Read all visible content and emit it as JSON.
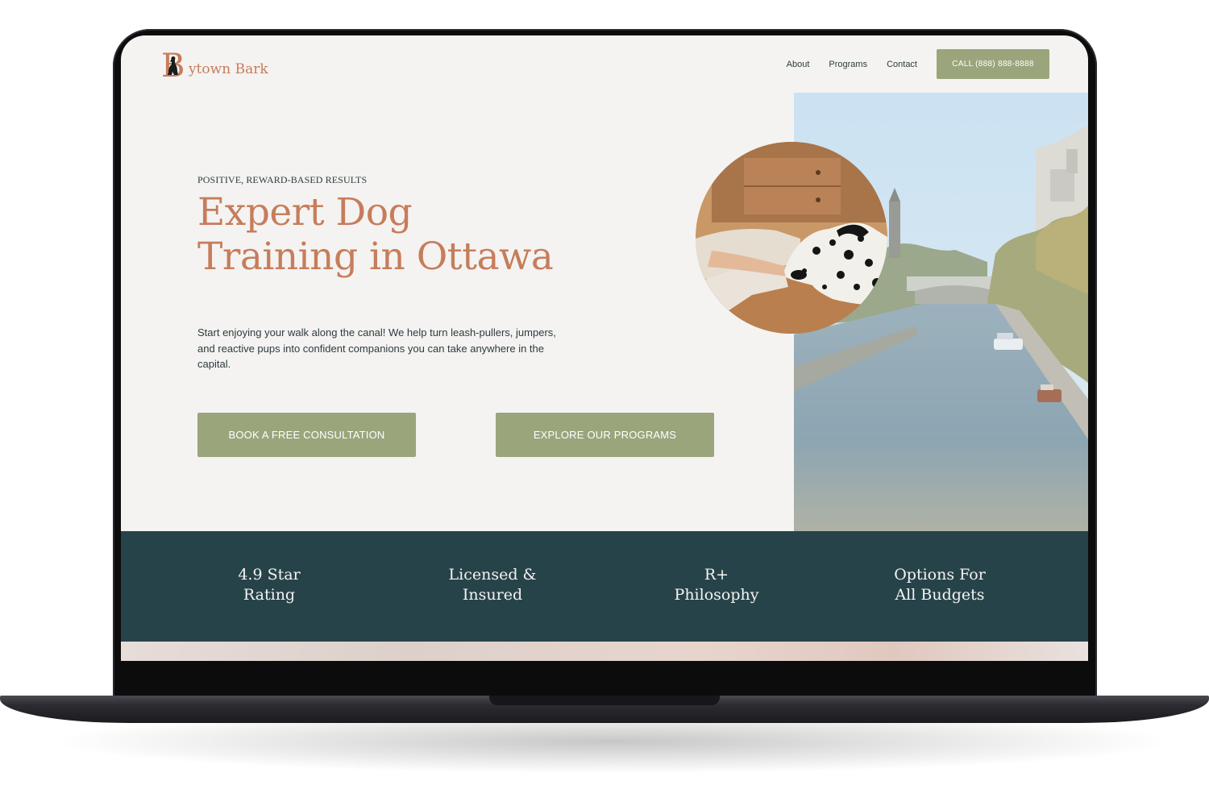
{
  "header": {
    "logo_letter": "B",
    "logo_text": "ytown Bark",
    "nav": [
      {
        "label": "About"
      },
      {
        "label": "Programs"
      },
      {
        "label": "Contact"
      }
    ],
    "call_button": "CALL (888) 888-8888"
  },
  "hero": {
    "eyebrow": "POSITIVE, REWARD-BASED RESULTS",
    "headline_line1": "Expert Dog",
    "headline_line2": "Training in Ottawa",
    "intro": "Start enjoying your walk along the canal! We help turn leash-pullers, jumpers, and reactive pups into confident companions you can take anywhere in the capital.",
    "primary_button": "BOOK A FREE CONSULTATION",
    "secondary_button": "EXPLORE OUR PROGRAMS"
  },
  "stats": [
    {
      "line1": "4.9 Star",
      "line2": "Rating"
    },
    {
      "line1": "Licensed &",
      "line2": "Insured"
    },
    {
      "line1": "R+",
      "line2": "Philosophy"
    },
    {
      "line1": "Options For",
      "line2": "All Budgets"
    }
  ],
  "colors": {
    "accent_terracotta": "#c67d5b",
    "button_sage": "#9aa57c",
    "band_teal": "#27434a",
    "page_bg": "#f4f3f1",
    "text_dark": "#2d3b3e"
  },
  "icons": {
    "logo": "dog-silhouette-in-letter-b"
  }
}
